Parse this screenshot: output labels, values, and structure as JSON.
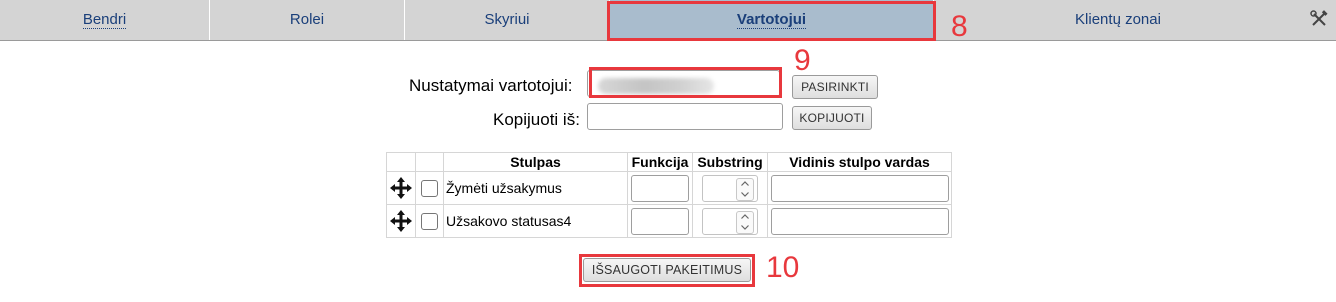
{
  "tabs": [
    {
      "label": "Bendri"
    },
    {
      "label": "Rolei"
    },
    {
      "label": "Skyriui"
    },
    {
      "label": "Vartotojui",
      "active": true
    },
    {
      "label": "Klientų zonai"
    }
  ],
  "tools_icon": "crossed-tools-icon",
  "annotations": {
    "a8": "8",
    "a9": "9",
    "a10": "10",
    "color": "#e8383d"
  },
  "form": {
    "user_label": "Nustatymai vartotojui:",
    "user_value_blurred": true,
    "select_button": "PASIRINKTI",
    "copy_label": "Kopijuoti iš:",
    "copy_value": "",
    "copy_button": "KOPIJUOTI"
  },
  "table": {
    "headers": [
      "Stulpas",
      "Funkcija",
      "Substring",
      "Vidinis stulpo vardas"
    ],
    "rows": [
      {
        "name": "Žymėti užsakymus",
        "function": "",
        "substring": "",
        "internal_name": ""
      },
      {
        "name": "Užsakovo statusas4",
        "function": "",
        "substring": "",
        "internal_name": ""
      }
    ]
  },
  "save_button": "IŠSAUGOTI PAKEITIMUS",
  "colors": {
    "tabbar": "#d4d4d4",
    "active_tab": "#a9bccd",
    "tab_text": "#1a3f7a"
  }
}
